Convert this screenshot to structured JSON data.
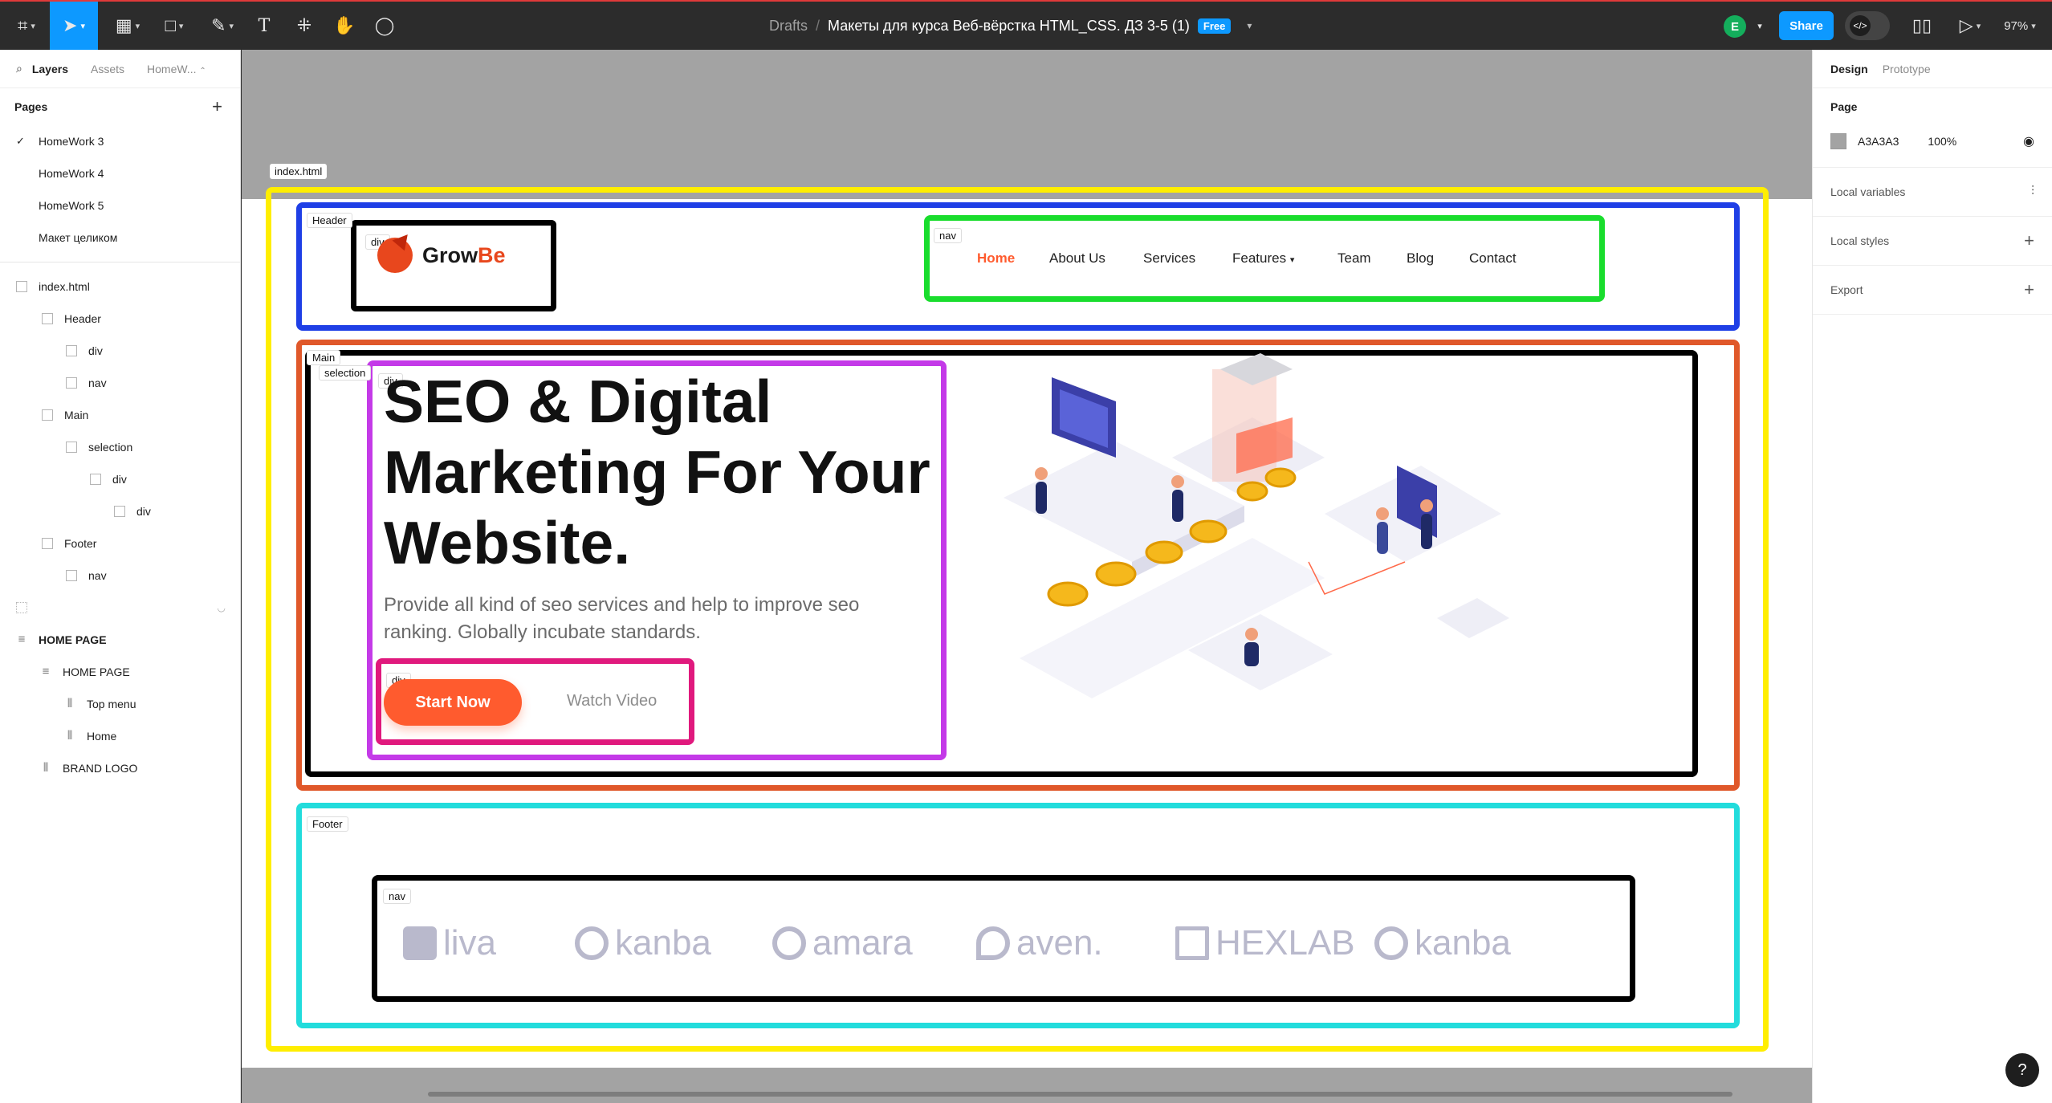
{
  "toolbar": {
    "breadcrumb_drafts": "Drafts",
    "breadcrumb_sep": "/",
    "file_name": "Макеты для курса Веб-вёрстка HTML_CSS. ДЗ 3-5 (1)",
    "plan_badge": "Free",
    "avatar_initial": "E",
    "share_label": "Share",
    "zoom": "97%"
  },
  "left_panel": {
    "tabs": [
      "Layers",
      "Assets",
      "HomeW..."
    ],
    "pages_title": "Pages",
    "pages": [
      "HomeWork 3",
      "HomeWork 4",
      "HomeWork 5",
      "Макет целиком"
    ],
    "layers": [
      {
        "label": "index.html",
        "depth": 0
      },
      {
        "label": "Header",
        "depth": 1
      },
      {
        "label": "div",
        "depth": 2
      },
      {
        "label": "nav",
        "depth": 2
      },
      {
        "label": "Main",
        "depth": 1
      },
      {
        "label": "selection",
        "depth": 2
      },
      {
        "label": "div",
        "depth": 3
      },
      {
        "label": "div",
        "depth": 4
      },
      {
        "label": "Footer",
        "depth": 1
      },
      {
        "label": "nav",
        "depth": 2
      },
      {
        "label": "HOME PAGE",
        "depth": 0
      },
      {
        "label": "HOME PAGE",
        "depth": 1
      },
      {
        "label": "Top menu",
        "depth": 2
      },
      {
        "label": "Home",
        "depth": 2
      },
      {
        "label": "BRAND LOGO",
        "depth": 1
      }
    ]
  },
  "right_panel": {
    "tabs": [
      "Design",
      "Prototype"
    ],
    "page_title": "Page",
    "page_color": "A3A3A3",
    "page_opacity": "100%",
    "sections": [
      "Local variables",
      "Local styles",
      "Export"
    ]
  },
  "canvas": {
    "frame_label": "index.html",
    "tags": {
      "header": "Header",
      "header_div": "div",
      "header_nav": "nav",
      "main": "Main",
      "selection": "selection",
      "hero_div": "div",
      "buttons_div": "div",
      "footer": "Footer",
      "footer_nav": "nav"
    }
  },
  "site": {
    "logo_grow": "Grow",
    "logo_be": "Be",
    "nav": [
      "Home",
      "About Us",
      "Services",
      "Features",
      "Team",
      "Blog",
      "Contact"
    ],
    "hero_title": "SEO & Digital Marketing For Your Website.",
    "hero_subtitle": "Provide all kind of seo services and help to improve seo ranking. Globally incubate standards.",
    "cta_primary": "Start Now",
    "cta_secondary": "Watch Video",
    "partners": [
      "liva",
      "kanba",
      "amara",
      "aven.",
      "HEXLAB",
      "kanba"
    ]
  },
  "colors": {
    "accent": "#ff5b2e",
    "figma_blue": "#0d99ff",
    "outline_yellow": "#ffee00",
    "outline_blue": "#1f3fe6",
    "outline_green": "#19dd2d",
    "outline_orange": "#e0582a",
    "outline_purple": "#c43ae8",
    "outline_pink": "#e0197d",
    "outline_cyan": "#22dcdc"
  }
}
